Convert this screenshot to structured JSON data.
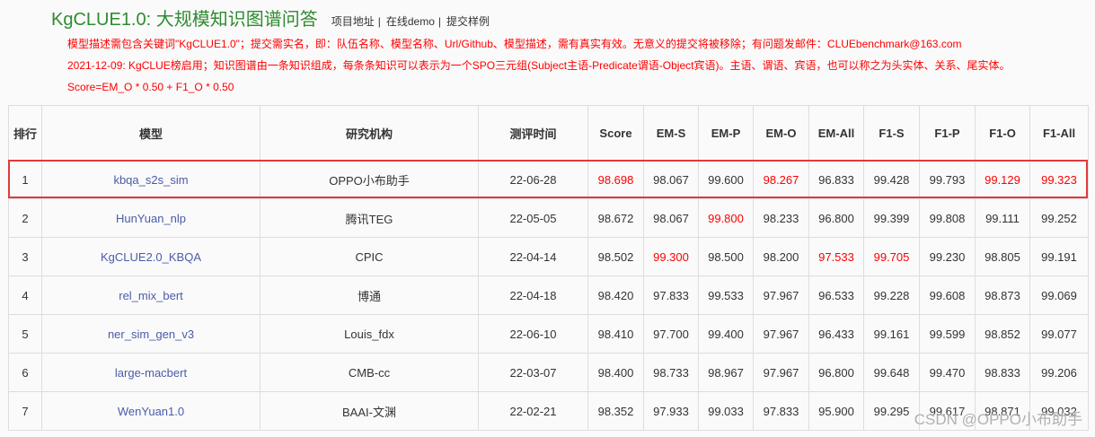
{
  "header": {
    "title": "KgCLUE1.0: 大规模知识图谱问答",
    "separator": "|",
    "links": [
      {
        "label": "项目地址"
      },
      {
        "label": "在线demo"
      },
      {
        "label": "提交样例"
      }
    ]
  },
  "notices": [
    "模型描述需包含关键词\"KgCLUE1.0\"；提交需实名，即：队伍名称、模型名称、Url/Github、模型描述，需有真实有效。无意义的提交将被移除；有问题发邮件：CLUEbenchmark@163.com",
    "2021-12-09: KgCLUE榜启用；知识图谱由一条知识组成，每条条知识可以表示为一个SPO三元组(Subject主语-Predicate谓语-Object宾语)。主语、谓语、宾语，也可以称之为头实体、关系、尾实体。",
    "Score=EM_O * 0.50 + F1_O * 0.50"
  ],
  "table": {
    "columns": [
      "排行",
      "模型",
      "研究机构",
      "测评时间",
      "Score",
      "EM-S",
      "EM-P",
      "EM-O",
      "EM-All",
      "F1-S",
      "F1-P",
      "F1-O",
      "F1-All"
    ],
    "rows": [
      {
        "rank": "1",
        "model": "kbqa_s2s_sim",
        "org": "OPPO小布助手",
        "date": "22-06-28",
        "highlighted": true,
        "scores": [
          {
            "v": "98.698",
            "best": true
          },
          {
            "v": "98.067"
          },
          {
            "v": "99.600"
          },
          {
            "v": "98.267",
            "best": true
          },
          {
            "v": "96.833"
          },
          {
            "v": "99.428"
          },
          {
            "v": "99.793"
          },
          {
            "v": "99.129",
            "best": true
          },
          {
            "v": "99.323",
            "best": true
          }
        ]
      },
      {
        "rank": "2",
        "model": "HunYuan_nlp",
        "org": "腾讯TEG",
        "date": "22-05-05",
        "scores": [
          {
            "v": "98.672"
          },
          {
            "v": "98.067"
          },
          {
            "v": "99.800",
            "best": true
          },
          {
            "v": "98.233"
          },
          {
            "v": "96.800"
          },
          {
            "v": "99.399"
          },
          {
            "v": "99.808"
          },
          {
            "v": "99.111"
          },
          {
            "v": "99.252"
          }
        ]
      },
      {
        "rank": "3",
        "model": "KgCLUE2.0_KBQA",
        "org": "CPIC",
        "date": "22-04-14",
        "scores": [
          {
            "v": "98.502"
          },
          {
            "v": "99.300",
            "best": true
          },
          {
            "v": "98.500"
          },
          {
            "v": "98.200"
          },
          {
            "v": "97.533",
            "best": true
          },
          {
            "v": "99.705",
            "best": true
          },
          {
            "v": "99.230"
          },
          {
            "v": "98.805"
          },
          {
            "v": "99.191"
          }
        ]
      },
      {
        "rank": "4",
        "model": "rel_mix_bert",
        "org": "博通",
        "date": "22-04-18",
        "scores": [
          {
            "v": "98.420"
          },
          {
            "v": "97.833"
          },
          {
            "v": "99.533"
          },
          {
            "v": "97.967"
          },
          {
            "v": "96.533"
          },
          {
            "v": "99.228"
          },
          {
            "v": "99.608"
          },
          {
            "v": "98.873"
          },
          {
            "v": "99.069"
          }
        ]
      },
      {
        "rank": "5",
        "model": "ner_sim_gen_v3",
        "org": "Louis_fdx",
        "date": "22-06-10",
        "scores": [
          {
            "v": "98.410"
          },
          {
            "v": "97.700"
          },
          {
            "v": "99.400"
          },
          {
            "v": "97.967"
          },
          {
            "v": "96.433"
          },
          {
            "v": "99.161"
          },
          {
            "v": "99.599"
          },
          {
            "v": "98.852"
          },
          {
            "v": "99.077"
          }
        ]
      },
      {
        "rank": "6",
        "model": "large-macbert",
        "org": "CMB-cc",
        "date": "22-03-07",
        "scores": [
          {
            "v": "98.400"
          },
          {
            "v": "98.733"
          },
          {
            "v": "98.967"
          },
          {
            "v": "97.967"
          },
          {
            "v": "96.800"
          },
          {
            "v": "99.648"
          },
          {
            "v": "99.470"
          },
          {
            "v": "98.833"
          },
          {
            "v": "99.206"
          }
        ]
      },
      {
        "rank": "7",
        "model": "WenYuan1.0",
        "org": "BAAI-文渊",
        "date": "22-02-21",
        "scores": [
          {
            "v": "98.352"
          },
          {
            "v": "97.933"
          },
          {
            "v": "99.033"
          },
          {
            "v": "97.833"
          },
          {
            "v": "95.900"
          },
          {
            "v": "99.295"
          },
          {
            "v": "99.617"
          },
          {
            "v": "98.871"
          },
          {
            "v": "99.032"
          }
        ]
      }
    ]
  },
  "watermark": "CSDN @OPPO小布助手",
  "colors": {
    "title": "#2e8b30",
    "notice": "#ff0000",
    "link": "#4b5ca8",
    "best": "#ff0000",
    "highlight": "#e03a3a"
  }
}
